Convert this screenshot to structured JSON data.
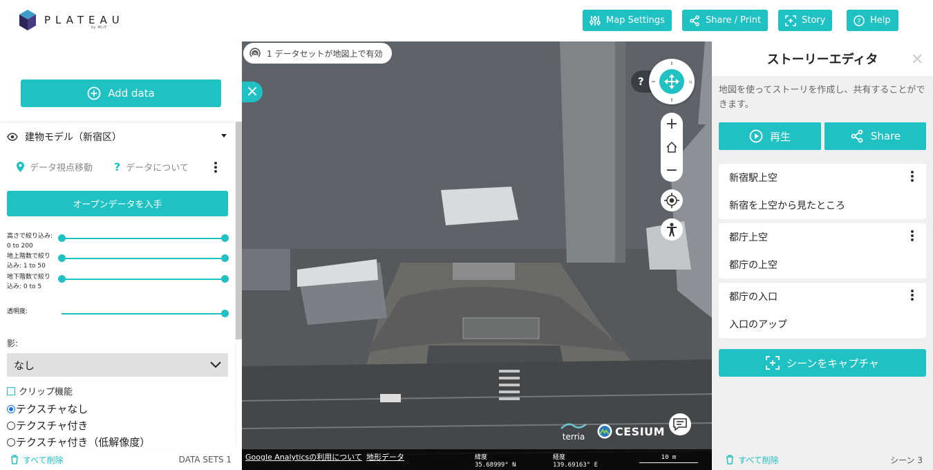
{
  "header": {
    "logo_text": "PLATEAU",
    "logo_sub": "by MLIT",
    "buttons": {
      "map_settings": "Map Settings",
      "share_print": "Share / Print",
      "story": "Story",
      "help": "Help"
    }
  },
  "left_panel": {
    "add_data": "Add data",
    "dataset": {
      "title": "建物モデル（新宿区）",
      "zoom_to": "データ視点移動",
      "about": "データについて",
      "open_data_button": "オープンデータを入手",
      "sliders": [
        {
          "label_1": "高さで絞り込み:",
          "label_2": "0 to 200",
          "min_fraction": 0.0,
          "max_fraction": 1.0
        },
        {
          "label_1": "地上階数で絞り",
          "label_2": "込み: 1 to 50",
          "min_fraction": 0.0,
          "max_fraction": 1.0
        },
        {
          "label_1": "地下階数で絞り",
          "label_2": "込み: 0 to 5",
          "min_fraction": 0.0,
          "max_fraction": 1.0
        }
      ],
      "opacity_label": "透明度:",
      "opacity_fraction": 1.0,
      "shadow_label": "影:",
      "shadow_value": "なし",
      "clip_label": "クリップ機能",
      "texture_options": [
        "テクスチャなし",
        "テクスチャ付き",
        "テクスチャ付き（低解像度）"
      ],
      "texture_selected": "テクスチャなし"
    },
    "footer": {
      "remove_all": "すべて削除",
      "datasets_count": "DATA SETS 1"
    }
  },
  "map": {
    "status_pill": "1 データセットが地図上で有効",
    "help_glyph": "?",
    "zoom_in": "+",
    "zoom_out": "−",
    "brand_terria": "terria",
    "brand_cesium": "CESIUM",
    "footer": {
      "analytics_link": "Google Analyticsの利用について",
      "terrain_link": "地形データ",
      "lat_label": "緯度",
      "lat_value": "35.68999° N",
      "lon_label": "経度",
      "lon_value": "139.69163° E",
      "scale": "10 m"
    }
  },
  "story_panel": {
    "title": "ストーリーエディタ",
    "description": "地図を使ってストーリを作成し、共有することができます。",
    "play_button": "再生",
    "share_button": "Share",
    "scenes": [
      {
        "title": "新宿駅上空",
        "description": "新宿を上空から見たところ"
      },
      {
        "title": "都庁上空",
        "description": "都庁の上空"
      },
      {
        "title": "都庁の入口",
        "description": "入口のアップ"
      }
    ],
    "capture_button": "シーンをキャプチャ",
    "footer": {
      "remove_all": "すべて削除",
      "scene_count": "シーン 3"
    }
  },
  "colors": {
    "accent": "#1fc1c3",
    "map_ground": "#5e646a",
    "panel_bg": "#f0f0f0"
  }
}
